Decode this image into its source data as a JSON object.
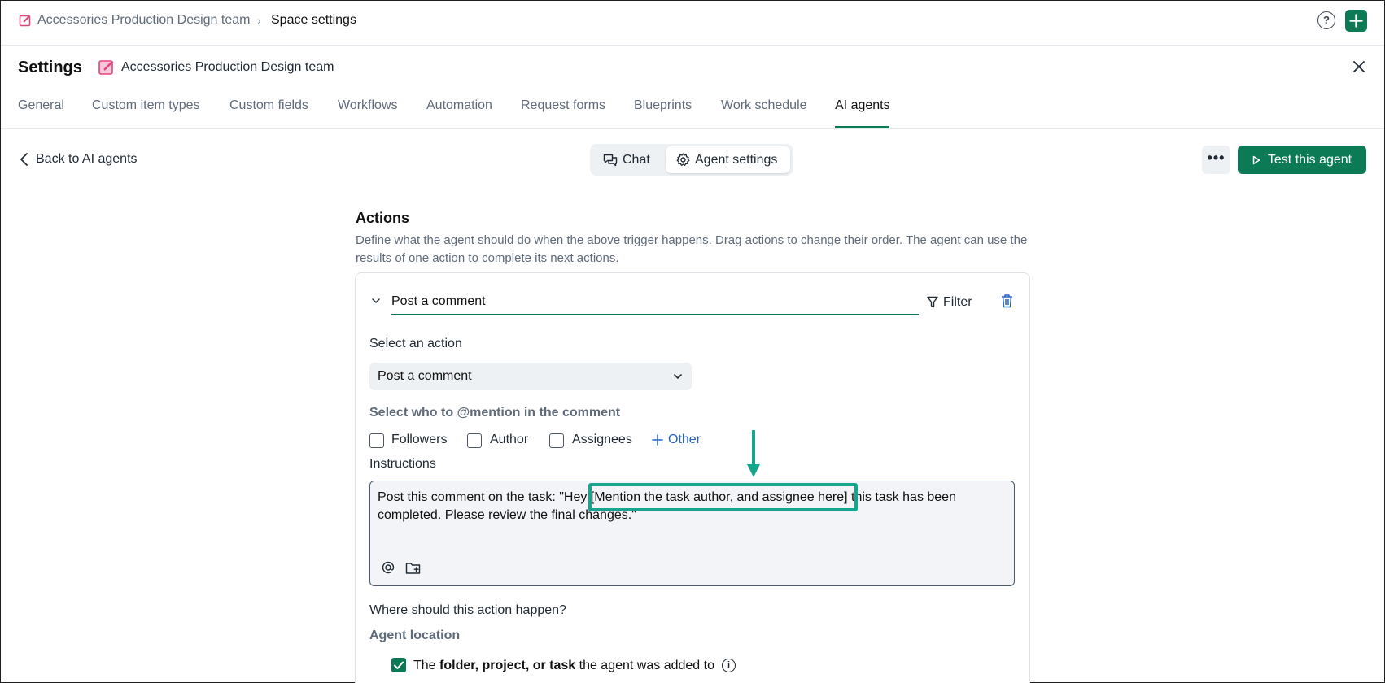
{
  "breadcrumb": {
    "space": "Accessories Production Design team",
    "current": "Space settings"
  },
  "header": {
    "title": "Settings",
    "team_name": "Accessories Production Design team"
  },
  "tabs": [
    {
      "label": "General"
    },
    {
      "label": "Custom item types"
    },
    {
      "label": "Custom fields"
    },
    {
      "label": "Workflows"
    },
    {
      "label": "Automation"
    },
    {
      "label": "Request forms"
    },
    {
      "label": "Blueprints"
    },
    {
      "label": "Work schedule"
    },
    {
      "label": "AI agents",
      "active": true
    }
  ],
  "toolbar": {
    "back_label": "Back to AI agents",
    "chat_label": "Chat",
    "agent_settings_label": "Agent settings",
    "more_label": "•••",
    "test_label": "Test this agent"
  },
  "actions": {
    "title": "Actions",
    "description": "Define what the agent should do when the above trigger happens. Drag actions to change their order. The agent can use the results of one action to complete its next actions.",
    "card": {
      "name": "Post a comment",
      "filter_label": "Filter",
      "select_action_label": "Select an action",
      "selected_action": "Post a comment",
      "mention_title": "Select who to @mention in the comment",
      "mention_options": [
        {
          "label": "Followers",
          "checked": false
        },
        {
          "label": "Author",
          "checked": false
        },
        {
          "label": "Assignees",
          "checked": false
        }
      ],
      "other_label": "Other",
      "instructions_label": "Instructions",
      "instructions_before": "Post this comment on the task: \"Hey ",
      "instructions_highlight": "[Mention the task author, and assignee here]",
      "instructions_after": " this task has been completed. Please review the final changes.\"",
      "where_label": "Where should this action happen?",
      "agent_location_title": "Agent location",
      "location_option": {
        "prefix": "The ",
        "bold": "folder, project, or task",
        "suffix": " the agent was added to",
        "checked": true
      }
    }
  },
  "colors": {
    "accent": "#0d7a56",
    "highlight": "#16a68e",
    "link": "#2563c9",
    "muted": "#5f6b7a"
  }
}
